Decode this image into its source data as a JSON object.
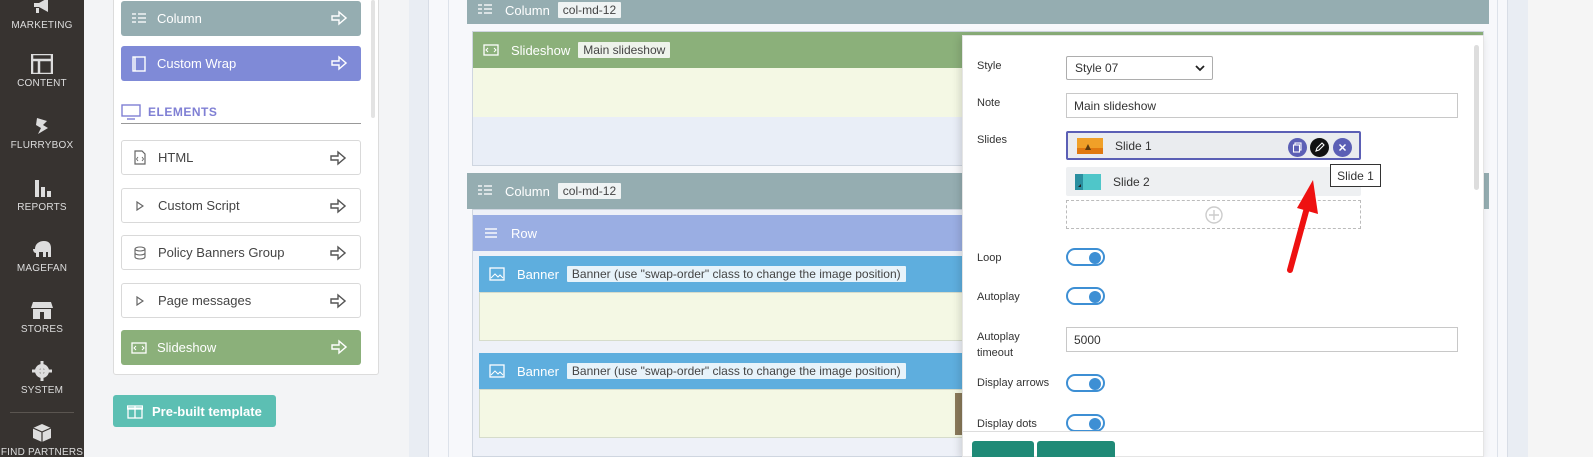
{
  "admin_nav": {
    "items": [
      {
        "label": "MARKETING",
        "icon": "megaphone-icon"
      },
      {
        "label": "CONTENT",
        "icon": "layout-icon"
      },
      {
        "label": "FLURRYBOX",
        "icon": "flurrybox-icon"
      },
      {
        "label": "REPORTS",
        "icon": "bar-chart-icon"
      },
      {
        "label": "MAGEFAN",
        "icon": "elephant-icon"
      },
      {
        "label": "STORES",
        "icon": "store-icon"
      },
      {
        "label": "SYSTEM",
        "icon": "gear-icon"
      },
      {
        "label": "FIND PARTNERS",
        "icon": "box-icon"
      }
    ]
  },
  "palette": {
    "layout_items": [
      {
        "label": "Column",
        "color": "#95adb1",
        "icon": "column-icon"
      },
      {
        "label": "Custom Wrap",
        "color": "#7f8ad7",
        "icon": "wrap-icon"
      }
    ],
    "elements_section": "ELEMENTS",
    "element_items": [
      {
        "label": "HTML",
        "icon": "html-file-icon"
      },
      {
        "label": "Custom Script",
        "icon": "play-icon"
      },
      {
        "label": "Policy Banners Group",
        "icon": "database-icon"
      },
      {
        "label": "Page messages",
        "icon": "play-icon"
      }
    ],
    "active_item": {
      "label": "Slideshow",
      "color": "#8bb07a",
      "icon": "slideshow-icon"
    },
    "prebuilt_button": "Pre-built template"
  },
  "canvas": {
    "column1": {
      "label": "Column",
      "tag": "col-md-12",
      "color": "#95adb1"
    },
    "slideshow": {
      "label": "Slideshow",
      "tag": "Main slideshow",
      "color": "#8bb07a"
    },
    "column2": {
      "label": "Column",
      "tag": "col-md-12",
      "color": "#95adb1"
    },
    "row": {
      "label": "Row",
      "color": "#9aaee3"
    },
    "banner1": {
      "label": "Banner",
      "tag": "Banner (use \"swap-order\" class to change the image position)",
      "color": "#5eaede"
    },
    "banner2": {
      "label": "Banner",
      "tag": "Banner (use \"swap-order\" class to change the image position)",
      "color": "#5eaede"
    }
  },
  "form": {
    "style_label": "Style",
    "style_value": "Style 07",
    "note_label": "Note",
    "note_value": "Main slideshow",
    "slides_label": "Slides",
    "slides": [
      {
        "label": "Slide 1"
      },
      {
        "label": "Slide 2"
      }
    ],
    "tooltip": "Slide 1",
    "loop_label": "Loop",
    "loop_on": true,
    "autoplay_label": "Autoplay",
    "autoplay_on": true,
    "autoplay_timeout_label_1": "Autoplay",
    "autoplay_timeout_label_2": "timeout",
    "autoplay_timeout_value": "5000",
    "display_arrows_label": "Display arrows",
    "display_arrows_on": true,
    "display_dots_label": "Display dots",
    "display_dots_on": true
  }
}
